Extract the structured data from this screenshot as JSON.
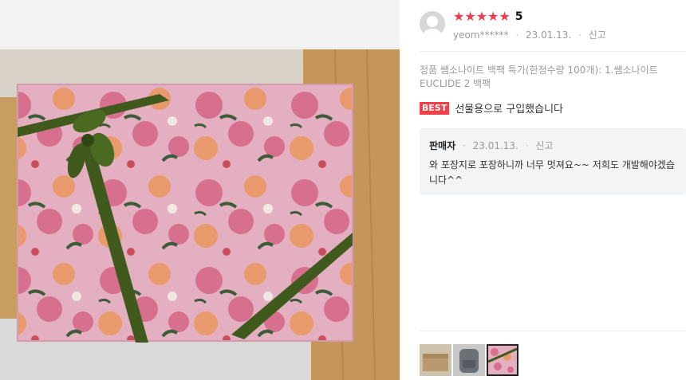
{
  "photo": {
    "icon": "gift-box-photo",
    "colors": {
      "wrap": "#e3aebf",
      "ribbon": "#3f5a1c",
      "wood": "#c99d62"
    }
  },
  "review": {
    "rating": 5,
    "rating_label": "5",
    "stars": [
      "★",
      "★",
      "★",
      "★",
      "★"
    ],
    "username": "yeom******",
    "date": "23.01.13.",
    "report_label": "신고",
    "option_text": "정품 쌤소나이트 백팩 특가(한정수량 100개): 1.쌤소나이트 EUCLIDE 2 백팩",
    "best_badge": "BEST",
    "text": "선물용으로 구입했습니다"
  },
  "reply": {
    "seller_label": "판매자",
    "date": "23.01.13.",
    "report_label": "신고",
    "text": "와 포장지로 포장하니까 너무 멋져요~~ 저희도 개발해야겠습니다^^"
  },
  "thumbnails": [
    "thumb-cardboard-box",
    "thumb-gray-backpack",
    "thumb-gift-wrap"
  ],
  "colors": {
    "accent": "#f03c4b",
    "reply_bg": "#f3f4f6"
  }
}
